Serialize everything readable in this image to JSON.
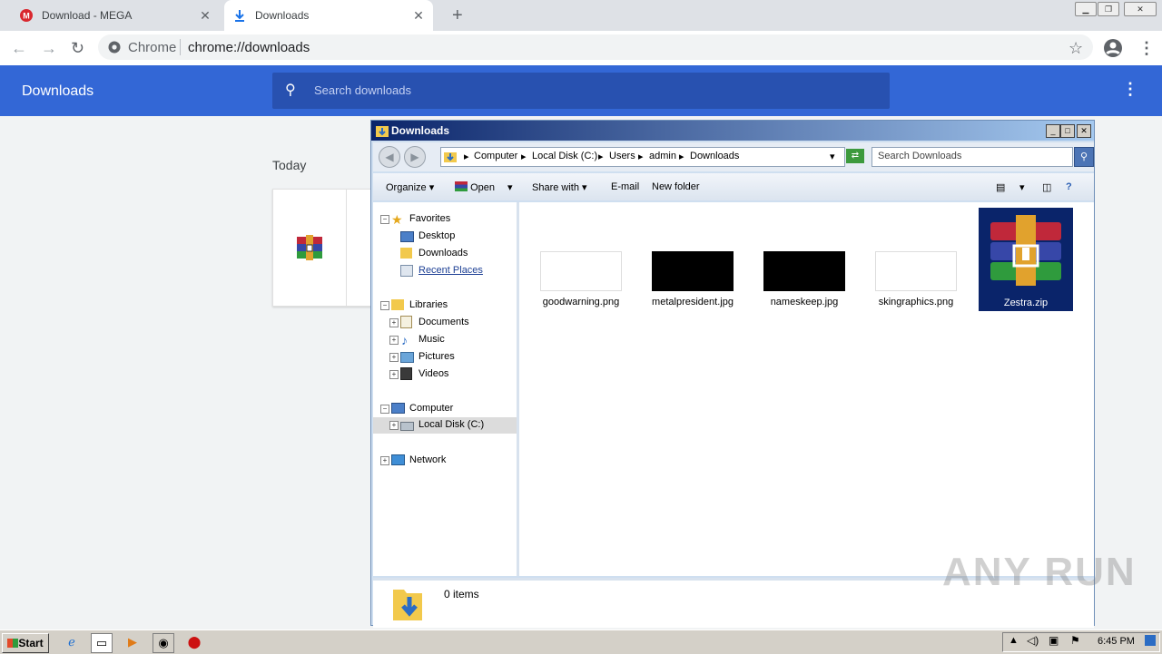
{
  "browser": {
    "tabs": [
      {
        "title": "Download - MEGA",
        "favicon": "mega-icon"
      },
      {
        "title": "Downloads",
        "favicon": "download-icon"
      }
    ],
    "new_tab": "+",
    "omnibox": {
      "origin_label": "Chrome",
      "url": "chrome://downloads"
    }
  },
  "downloads_page": {
    "title": "Downloads",
    "search_placeholder": "Search downloads",
    "section_date": "Today"
  },
  "explorer": {
    "title": "Downloads",
    "breadcrumb": [
      "Computer",
      "Local Disk (C:)",
      "Users",
      "admin",
      "Downloads"
    ],
    "search_placeholder": "Search Downloads",
    "commands": {
      "organize": "Organize",
      "open": "Open",
      "share_with": "Share with",
      "email": "E-mail",
      "new_folder": "New folder"
    },
    "nav": {
      "favorites": "Favorites",
      "desktop": "Desktop",
      "downloads": "Downloads",
      "recent_places": "Recent Places",
      "libraries": "Libraries",
      "documents": "Documents",
      "music": "Music",
      "pictures": "Pictures",
      "videos": "Videos",
      "computer": "Computer",
      "local_disk": "Local Disk (C:)",
      "network": "Network"
    },
    "files": [
      {
        "name": "goodwarning.png",
        "thumb": "#ffffff"
      },
      {
        "name": "metalpresident.jpg",
        "thumb": "#000000"
      },
      {
        "name": "nameskeep.jpg",
        "thumb": "#000000"
      },
      {
        "name": "skingraphics.png",
        "thumb": "#ffffff"
      },
      {
        "name": "Zestra.zip",
        "thumb": "winrar-icon",
        "selected": true
      }
    ],
    "status": "0 items"
  },
  "taskbar": {
    "start": "Start",
    "clock": "6:45 PM"
  },
  "watermark": "ANY RUN",
  "colors": {
    "chrome_blue": "#3367d6",
    "selection": "#0a246a"
  }
}
